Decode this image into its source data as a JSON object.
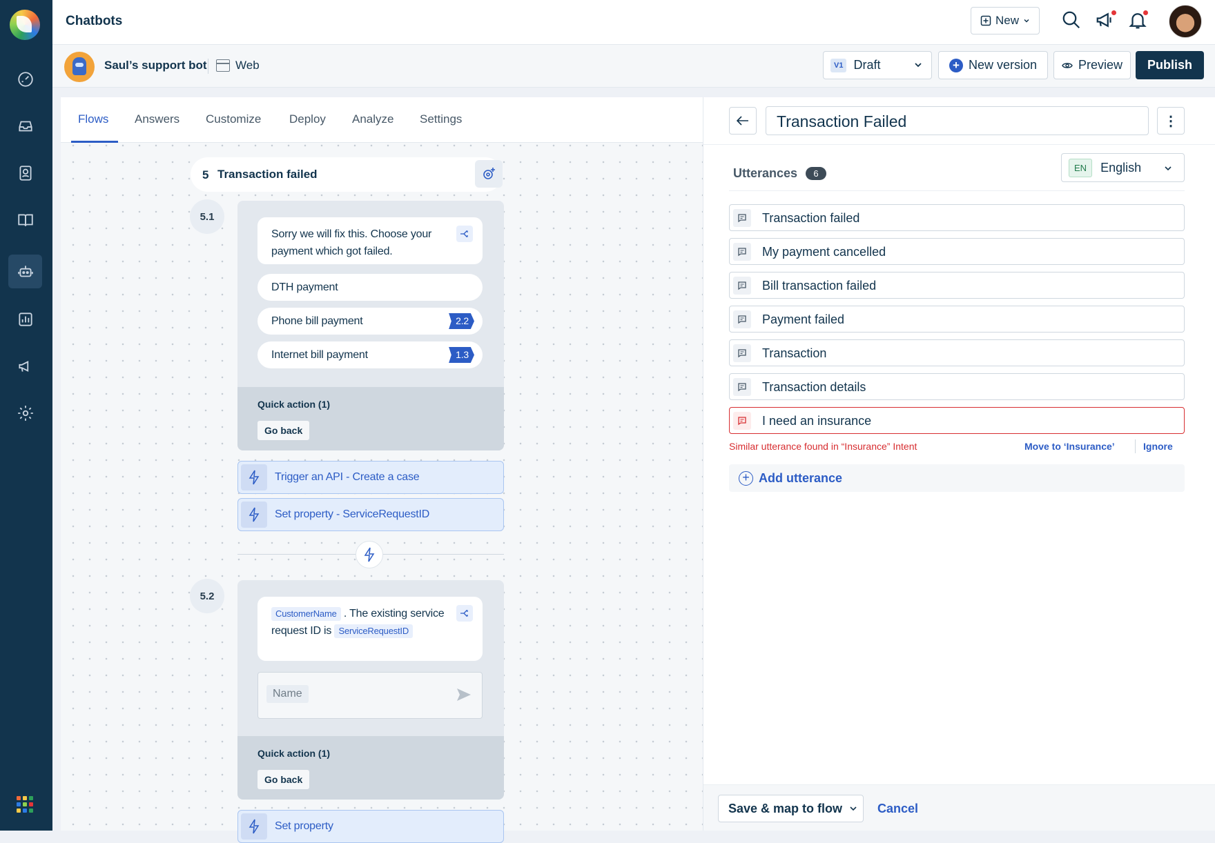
{
  "header": {
    "title": "Chatbots",
    "new_label": "New"
  },
  "bot": {
    "name": "Saul’s support bot",
    "channel": "Web"
  },
  "version": {
    "badge": "V1",
    "status": "Draft",
    "new_version_label": "New version",
    "preview_label": "Preview",
    "publish_label": "Publish"
  },
  "tabs": [
    "Flows",
    "Answers",
    "Customize",
    "Deploy",
    "Analyze",
    "Settings"
  ],
  "flow": {
    "step_number": "5",
    "step_title": "Transaction failed",
    "sub1": {
      "number": "5.1",
      "message": "Sorry we will fix this. Choose your payment which got failed.",
      "options": [
        {
          "label": "DTH payment",
          "badge": ""
        },
        {
          "label": "Phone bill payment",
          "badge": "2.2"
        },
        {
          "label": "Internet bill payment",
          "badge": "1.3"
        }
      ],
      "quick_action_title": "Quick action (1)",
      "quick_action_button": "Go back"
    },
    "actions": [
      "Trigger an API - Create a case",
      "Set property - ServiceRequestID"
    ],
    "sub2": {
      "number": "5.2",
      "tag1": "CustomerName",
      "message_mid": ". The existing service request ID is",
      "tag2": "ServiceRequestID",
      "input_placeholder": "Name",
      "quick_action_title": "Quick action (1)",
      "quick_action_button": "Go back"
    },
    "next_action": "Set property"
  },
  "panel": {
    "title": "Transaction Failed",
    "utterances_label": "Utterances",
    "utterances_count": "6",
    "language_code": "EN",
    "language": "English",
    "utterances": [
      "Transaction failed",
      "My payment cancelled",
      "Bill transaction failed",
      "Payment failed",
      "Transaction",
      "Transaction details"
    ],
    "error_utterance": "I need an insurance",
    "error_message": "Similar utterance found in “Insurance” Intent",
    "move_label": "Move to ‘Insurance’",
    "ignore_label": "Ignore",
    "add_label": "Add utterance",
    "save_label": "Save & map to flow",
    "cancel_label": "Cancel"
  },
  "colors": {
    "sidebar": "#12344d",
    "accent": "#2c5cc5",
    "error": "#d72d30",
    "publish": "#12344d"
  }
}
